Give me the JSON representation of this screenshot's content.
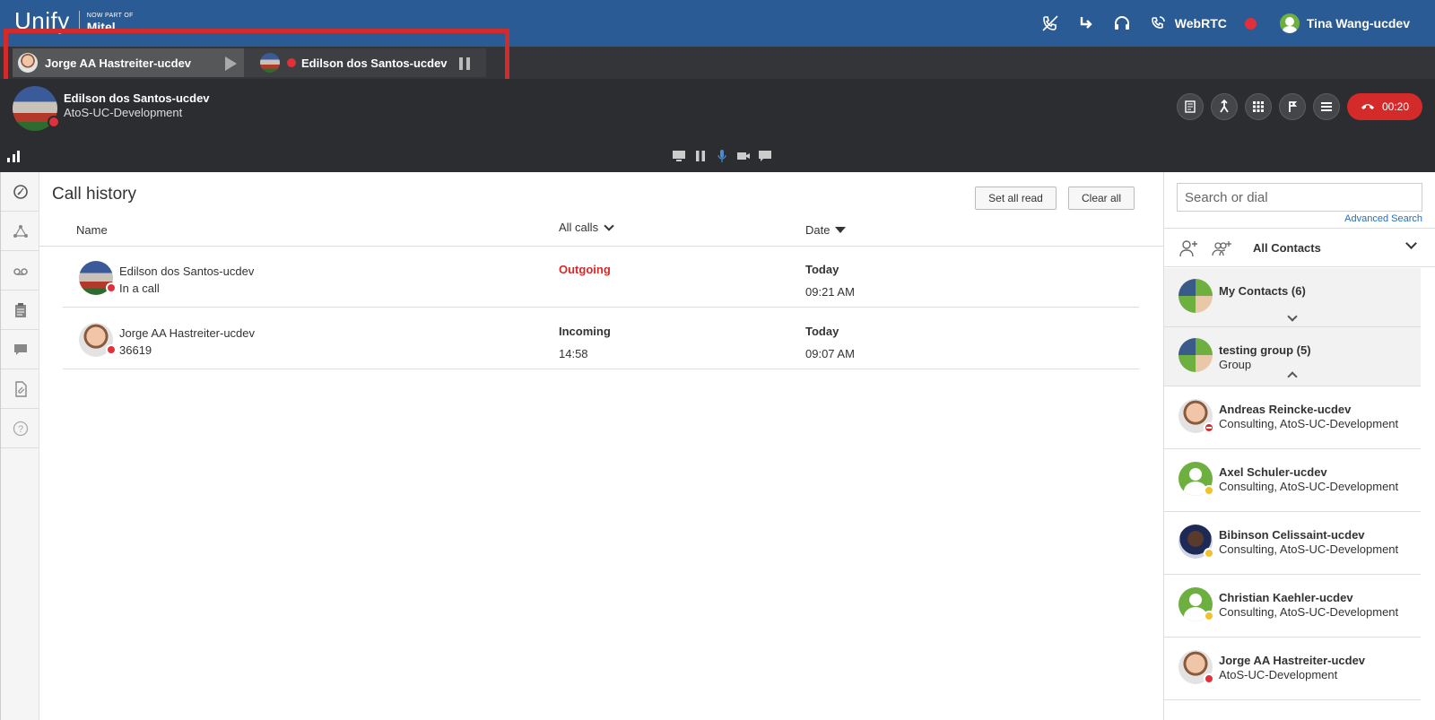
{
  "topbar": {
    "brand": "Unify",
    "brand_tagline_small": "NOW PART OF",
    "brand_tagline": "Mitel",
    "webrtc_label": "WebRTC",
    "user_name": "Tina Wang-ucdev",
    "icons": [
      "phone-off-icon",
      "call-forward-icon",
      "headset-icon",
      "webrtc-phone-icon",
      "recording-dot-icon"
    ]
  },
  "call_tabs": [
    {
      "name": "Jorge AA Hastreiter-ucdev",
      "state": "held"
    },
    {
      "name": "Edilson dos Santos-ucdev",
      "state": "active"
    }
  ],
  "active_call": {
    "name": "Edilson dos Santos-ucdev",
    "org": "AtoS-UC-Development",
    "timer": "00:20",
    "colors": {
      "hangup": "#d42a2a",
      "status": "#e0303a"
    }
  },
  "call_history": {
    "title": "Call history",
    "set_all_read": "Set all read",
    "clear_all": "Clear all",
    "columns": {
      "name": "Name",
      "calls": "All calls",
      "date": "Date"
    },
    "rows": [
      {
        "name": "Edilson dos Santos-ucdev",
        "sub": "In a call",
        "type": "Outgoing",
        "duration": "",
        "day": "Today",
        "time": "09:21 AM"
      },
      {
        "name": "Jorge AA Hastreiter-ucdev",
        "sub": "36619",
        "type": "Incoming",
        "duration": "14:58",
        "day": "Today",
        "time": "09:07 AM"
      }
    ]
  },
  "contacts_panel": {
    "search_placeholder": "Search or dial",
    "advanced_search": "Advanced Search",
    "filter": "All Contacts",
    "groups": [
      {
        "name": "My Contacts (6)",
        "sub": ""
      },
      {
        "name": "testing group (5)",
        "sub": "Group"
      }
    ],
    "contacts": [
      {
        "name": "Andreas Reincke-ucdev",
        "sub": "Consulting, AtoS-UC-Development",
        "status": "dnd"
      },
      {
        "name": "Axel Schuler-ucdev",
        "sub": "Consulting, AtoS-UC-Development",
        "status": "away"
      },
      {
        "name": "Bibinson Celissaint-ucdev",
        "sub": "Consulting, AtoS-UC-Development",
        "status": "away"
      },
      {
        "name": "Christian Kaehler-ucdev",
        "sub": "Consulting, AtoS-UC-Development",
        "status": "away"
      },
      {
        "name": "Jorge AA Hastreiter-ucdev",
        "sub": "AtoS-UC-Development",
        "status": "busy"
      }
    ]
  }
}
